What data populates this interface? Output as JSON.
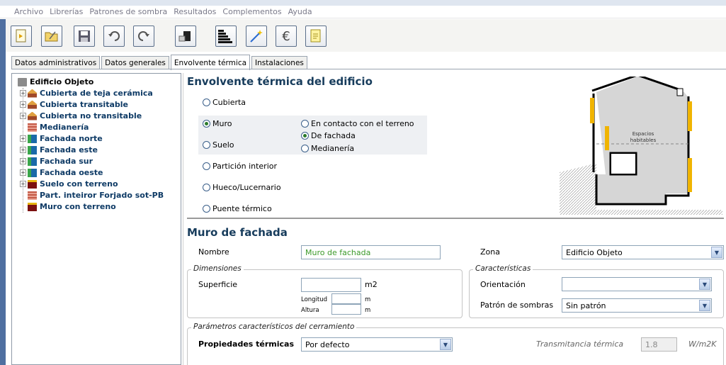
{
  "menu": [
    "Archivo",
    "Librerías",
    "Patrones de sombra",
    "Resultados",
    "Complementos",
    "Ayuda"
  ],
  "toolbar": {
    "buttons": [
      "new-icon",
      "open-icon",
      "save-icon",
      "undo-icon",
      "redo-icon",
      "import-icon",
      "energy-rating-icon",
      "wand-icon",
      "euro-icon",
      "report-icon"
    ],
    "euro_glyph": "€"
  },
  "tabs": [
    "Datos administrativos",
    "Datos generales",
    "Envolvente térmica",
    "Instalaciones"
  ],
  "active_tab": "Envolvente térmica",
  "tree": {
    "root": "Edificio Objeto",
    "items": [
      "Cubierta de teja cerámica",
      "Cubierta transitable",
      "Cubierta no transitable",
      "Medianería",
      "Fachada norte",
      "Fachada este",
      "Fachada sur",
      "Fachada oeste",
      "Suelo con terreno",
      "Part. inteiror Forjado sot-PB",
      "Muro con terreno"
    ]
  },
  "envelope": {
    "title": "Envolvente térmica del edificio",
    "types": [
      "Cubierta",
      "Muro",
      "Suelo",
      "Partición interior",
      "Hueco/Lucernario",
      "Puente térmico"
    ],
    "selected_type": "Muro",
    "wall_subtypes": [
      "En contacto con el terreno",
      "De fachada",
      "Medianería"
    ],
    "selected_subtype": "De fachada",
    "diagram_label_1": "Espacios",
    "diagram_label_2": "habitables"
  },
  "form": {
    "title": "Muro de fachada",
    "nombre_label": "Nombre",
    "nombre_value": "Muro de fachada",
    "zona_label": "Zona",
    "zona_value": "Edificio Objeto",
    "dimensiones_legend": "Dimensiones",
    "superficie_label": "Superficie",
    "superficie_unit": "m2",
    "longitud_label": "Longitud",
    "longitud_unit": "m",
    "altura_label": "Altura",
    "altura_unit": "m",
    "caracteristicas_legend": "Características",
    "orientacion_label": "Orientación",
    "orientacion_value": "",
    "patron_label": "Patrón de sombras",
    "patron_value": "Sin patrón",
    "parametros_legend": "Parámetros característicos del cerramiento",
    "propiedades_label": "Propiedades térmicas",
    "propiedades_value": "Por defecto",
    "transmitancia_label": "Transmitancia térmica",
    "transmitancia_value": "1.8",
    "transmitancia_unit": "W/m2K"
  },
  "colors": {
    "accent_title": "#173c5c",
    "tree_text": "#0f3b66",
    "left_border": "#4f6fa0",
    "nombre_text": "#3c9a2a",
    "insulation": "#f0b400"
  }
}
